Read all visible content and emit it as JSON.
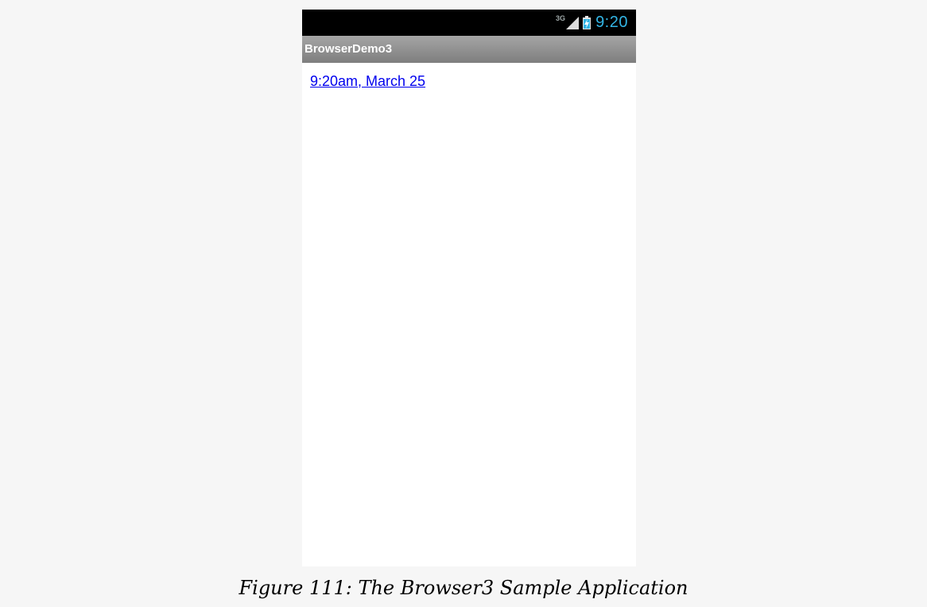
{
  "status_bar": {
    "network_type": "3G",
    "signal_icon": "signal-strength-icon",
    "battery_icon": "battery-charging-icon",
    "time": "9:20",
    "time_color": "#33b5e5"
  },
  "action_bar": {
    "title": "BrowserDemo3"
  },
  "web_content": {
    "link_text": "9:20am, March 25",
    "link_color": "#0000ee"
  },
  "caption": {
    "text": "Figure 111: The Browser3 Sample Application"
  }
}
